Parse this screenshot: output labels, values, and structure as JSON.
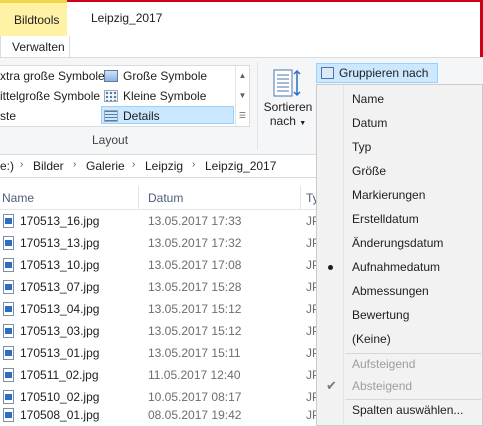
{
  "window": {
    "title": "Leipzig_2017"
  },
  "ribbon": {
    "context_tab": "Bildtools",
    "manage_tab": "Verwalten",
    "layout_group_label": "Layout",
    "layout_options": [
      {
        "label": "xtra große Symbole",
        "icon": "large-icons-icon"
      },
      {
        "label": "Große Symbole",
        "icon": "large-icons-icon"
      },
      {
        "label": "ittelgroße Symbole",
        "icon": "medium-icons-icon"
      },
      {
        "label": "Kleine Symbole",
        "icon": "small-icons-icon"
      },
      {
        "label": "ste",
        "icon": "list-icon"
      },
      {
        "label": "Details",
        "icon": "details-icon",
        "selected": true
      }
    ],
    "sort_button": {
      "line1": "Sortieren",
      "line2": "nach"
    },
    "group_button": {
      "label": "Gruppieren nach"
    }
  },
  "address": {
    "drive": "e:)",
    "crumbs": [
      "Bilder",
      "Galerie",
      "Leipzig",
      "Leipzig_2017"
    ]
  },
  "list": {
    "columns": [
      "Name",
      "Datum",
      "Ty"
    ],
    "rows": [
      {
        "name": "170513_16.jpg",
        "date": "13.05.2017 17:33",
        "type": "JP"
      },
      {
        "name": "170513_13.jpg",
        "date": "13.05.2017 17:32",
        "type": "JP"
      },
      {
        "name": "170513_10.jpg",
        "date": "13.05.2017 17:08",
        "type": "JP"
      },
      {
        "name": "170513_07.jpg",
        "date": "13.05.2017 15:28",
        "type": "JP"
      },
      {
        "name": "170513_04.jpg",
        "date": "13.05.2017 15:12",
        "type": "JP"
      },
      {
        "name": "170513_03.jpg",
        "date": "13.05.2017 15:12",
        "type": "JP"
      },
      {
        "name": "170513_01.jpg",
        "date": "13.05.2017 15:11",
        "type": "JP"
      },
      {
        "name": "170511_02.jpg",
        "date": "11.05.2017 12:40",
        "type": "JP"
      },
      {
        "name": "170510_02.jpg",
        "date": "10.05.2017 08:17",
        "type": "JP"
      },
      {
        "name": "170508_01.jpg",
        "date": "08.05.2017 19:42",
        "type": "JP"
      }
    ]
  },
  "menu": {
    "group_items": [
      "Name",
      "Datum",
      "Typ",
      "Größe",
      "Markierungen",
      "Erstelldatum",
      "Änderungsdatum",
      "Aufnahmedatum",
      "Abmessungen",
      "Bewertung",
      "(Keine)"
    ],
    "selected_group": "Aufnahmedatum",
    "order_items": [
      "Aufsteigend",
      "Absteigend"
    ],
    "selected_order": "Absteigend",
    "choose_columns": "Spalten auswählen..."
  },
  "colors": {
    "accent": "#cce8ff",
    "accent_border": "#99d1ff",
    "context_tab": "#fff2a5"
  }
}
